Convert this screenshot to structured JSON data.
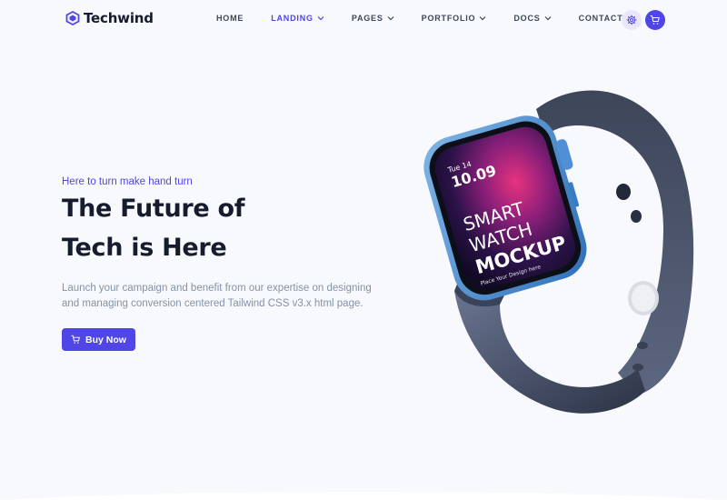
{
  "brand": {
    "name": "Techwind",
    "color": "#4f46e5"
  },
  "nav": {
    "items": [
      {
        "label": "HOME",
        "dropdown": false,
        "active": false
      },
      {
        "label": "LANDING",
        "dropdown": true,
        "active": true
      },
      {
        "label": "PAGES",
        "dropdown": true,
        "active": false
      },
      {
        "label": "PORTFOLIO",
        "dropdown": true,
        "active": false
      },
      {
        "label": "DOCS",
        "dropdown": true,
        "active": false
      },
      {
        "label": "CONTACT",
        "dropdown": false,
        "active": false
      }
    ],
    "settings_icon": "gear-icon",
    "cart_icon": "cart-icon"
  },
  "hero": {
    "subtitle": "Here to turn make hand turn",
    "title_line1": "The Future of",
    "title_line2": "Tech is Here",
    "description": "Launch your campaign and benefit from our expertise on designing and managing conversion centered Tailwind CSS v3.x html page.",
    "button_label": "Buy Now",
    "button_icon": "cart-icon"
  },
  "watch_screen": {
    "date": "Tue 14",
    "time": "10.09",
    "line1": "SMART",
    "line2": "WATCH",
    "line3": "MOCKUP",
    "tagline": "Place Your Design here"
  }
}
